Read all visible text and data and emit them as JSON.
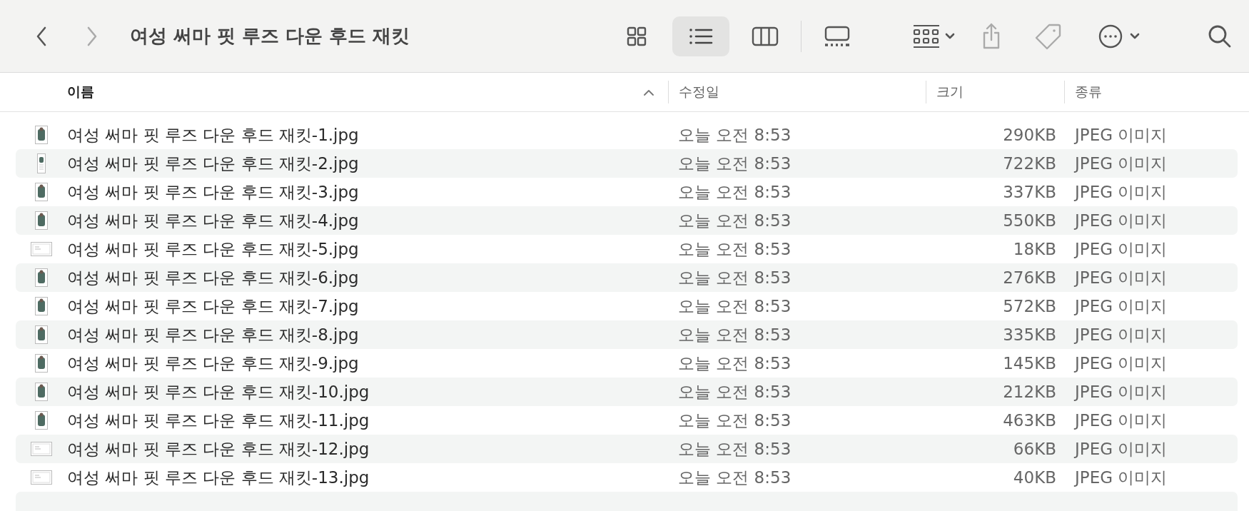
{
  "window": {
    "title": "여성 써마 핏 루즈 다운 후드 재킷"
  },
  "view_buttons": [
    {
      "kind": "icons",
      "selected": false
    },
    {
      "kind": "list",
      "selected": true
    },
    {
      "kind": "columns",
      "selected": false
    },
    {
      "kind": "gallery",
      "selected": false
    }
  ],
  "columns": [
    {
      "label": "이름",
      "sorted": true
    },
    {
      "label": "수정일",
      "sorted": false
    },
    {
      "label": "크기",
      "sorted": false
    },
    {
      "label": "종류",
      "sorted": false
    }
  ],
  "rows": [
    {
      "name": "여성 써마 핏 루즈 다운 후드 재킷-1.jpg",
      "modified": "오늘 오전 8:53",
      "size": "290KB",
      "type": "JPEG 이미지",
      "kind": "portrait"
    },
    {
      "name": "여성 써마 핏 루즈 다운 후드 재킷-2.jpg",
      "modified": "오늘 오전 8:53",
      "size": "722KB",
      "type": "JPEG 이미지",
      "kind": "tall"
    },
    {
      "name": "여성 써마 핏 루즈 다운 후드 재킷-3.jpg",
      "modified": "오늘 오전 8:53",
      "size": "337KB",
      "type": "JPEG 이미지",
      "kind": "portrait"
    },
    {
      "name": "여성 써마 핏 루즈 다운 후드 재킷-4.jpg",
      "modified": "오늘 오전 8:53",
      "size": "550KB",
      "type": "JPEG 이미지",
      "kind": "portrait"
    },
    {
      "name": "여성 써마 핏 루즈 다운 후드 재킷-5.jpg",
      "modified": "오늘 오전 8:53",
      "size": "18KB",
      "type": "JPEG 이미지",
      "kind": "landscape"
    },
    {
      "name": "여성 써마 핏 루즈 다운 후드 재킷-6.jpg",
      "modified": "오늘 오전 8:53",
      "size": "276KB",
      "type": "JPEG 이미지",
      "kind": "portrait"
    },
    {
      "name": "여성 써마 핏 루즈 다운 후드 재킷-7.jpg",
      "modified": "오늘 오전 8:53",
      "size": "572KB",
      "type": "JPEG 이미지",
      "kind": "portrait"
    },
    {
      "name": "여성 써마 핏 루즈 다운 후드 재킷-8.jpg",
      "modified": "오늘 오전 8:53",
      "size": "335KB",
      "type": "JPEG 이미지",
      "kind": "portrait"
    },
    {
      "name": "여성 써마 핏 루즈 다운 후드 재킷-9.jpg",
      "modified": "오늘 오전 8:53",
      "size": "145KB",
      "type": "JPEG 이미지",
      "kind": "portrait"
    },
    {
      "name": "여성 써마 핏 루즈 다운 후드 재킷-10.jpg",
      "modified": "오늘 오전 8:53",
      "size": "212KB",
      "type": "JPEG 이미지",
      "kind": "portrait"
    },
    {
      "name": "여성 써마 핏 루즈 다운 후드 재킷-11.jpg",
      "modified": "오늘 오전 8:53",
      "size": "463KB",
      "type": "JPEG 이미지",
      "kind": "portrait"
    },
    {
      "name": "여성 써마 핏 루즈 다운 후드 재킷-12.jpg",
      "modified": "오늘 오전 8:53",
      "size": "66KB",
      "type": "JPEG 이미지",
      "kind": "landscape"
    },
    {
      "name": "여성 써마 핏 루즈 다운 후드 재킷-13.jpg",
      "modified": "오늘 오전 8:53",
      "size": "40KB",
      "type": "JPEG 이미지",
      "kind": "landscape"
    }
  ]
}
